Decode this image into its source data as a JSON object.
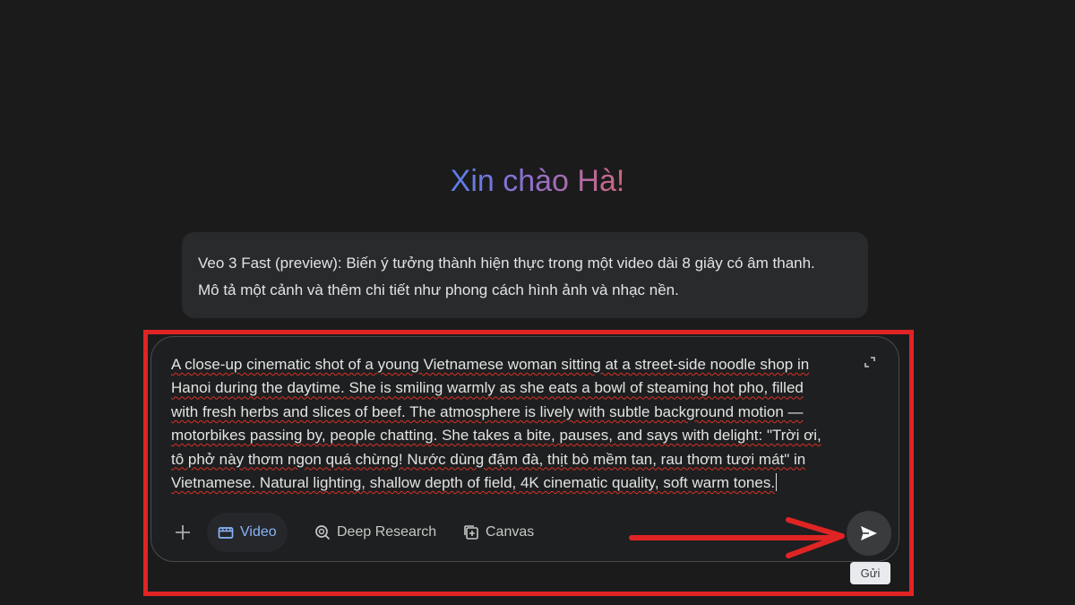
{
  "greeting": "Xin chào Hà!",
  "info_card": {
    "line1": "Veo 3 Fast (preview): Biến ý tưởng thành hiện thực trong một video dài 8 giây có âm thanh.",
    "line2": "Mô tả một cảnh và thêm chi tiết như phong cách hình ảnh và nhạc nền."
  },
  "prompt": {
    "lines": [
      "A close-up cinematic shot of a young Vietnamese woman sitting at a street-side noodle shop in",
      "Hanoi during the daytime. She is smiling warmly as she eats a bowl of steaming hot pho, filled",
      "with fresh herbs and slices of beef. The atmosphere is lively with subtle background motion —",
      "motorbikes passing by, people chatting. She takes a bite, pauses, and says with delight: \"Trời ơi,",
      "tô phở này thơm ngon quá chừng! Nước dùng đậm đà, thịt bò mềm tan, rau thơm tươi mát\" in",
      "Vietnamese. Natural lighting, shallow depth of field, 4K cinematic quality, soft warm tones."
    ]
  },
  "toolbar": {
    "plus_icon": "plus-icon",
    "tools": [
      {
        "label": "Video",
        "icon": "video-icon",
        "active": true
      },
      {
        "label": "Deep Research",
        "icon": "deep-research-icon",
        "active": false
      },
      {
        "label": "Canvas",
        "icon": "canvas-icon",
        "active": false
      }
    ]
  },
  "send": {
    "icon": "send-icon",
    "tooltip": "Gửi"
  },
  "colors": {
    "background": "#1b1b1c",
    "card": "#282a2c",
    "accent_blue": "#8ab4f8",
    "annotation_red": "#e02424"
  }
}
